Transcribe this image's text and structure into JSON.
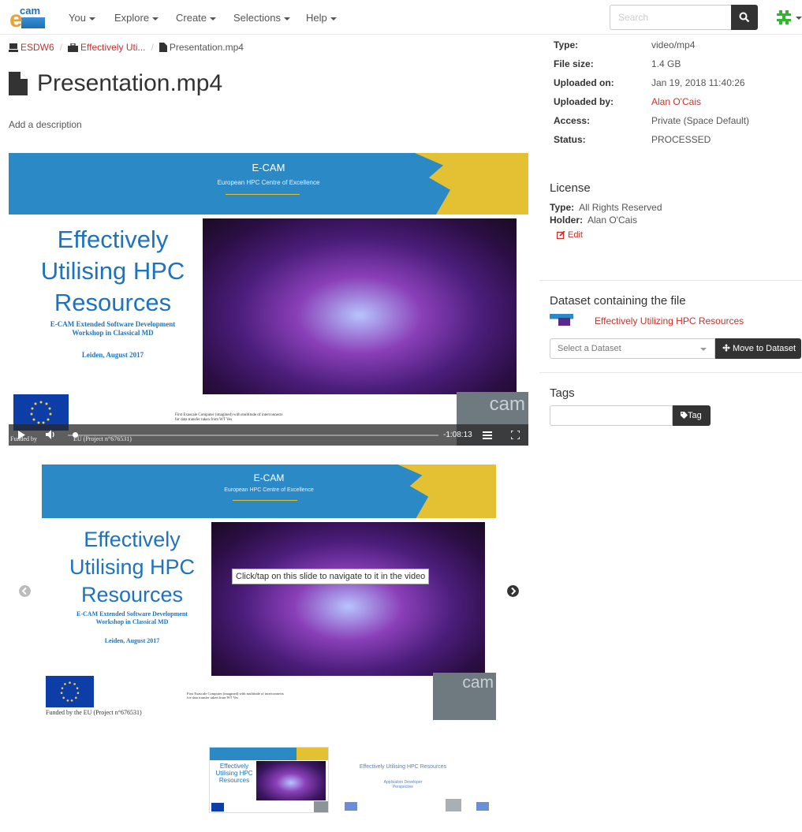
{
  "nav": {
    "logo_text": "cam",
    "logo_letter": "e",
    "items": [
      "You",
      "Explore",
      "Create",
      "Selections",
      "Help"
    ],
    "search_placeholder": "Search"
  },
  "breadcrumb": {
    "items": [
      "ESDW6",
      "Effectively Uti...",
      "Presentation.mp4"
    ]
  },
  "page": {
    "title": "Presentation.mp4",
    "add_description": "Add a description"
  },
  "slide": {
    "org": "E-CAM",
    "org_sub": "European HPC Centre of Excellence",
    "hero_lines": [
      "Effectively",
      "Utilising HPC",
      "Resources"
    ],
    "workshop_lines": [
      "E-CAM Extended Software Development",
      "Workshop in Classical MD"
    ],
    "location": "Leiden, August 2017",
    "caption_lines": [
      "First Exascale Computer (imagined) with multitude of interconnects",
      "for data transfer     taken from WT Ves"
    ],
    "funded": "Funded by the EU (Project n°676531)",
    "funded_partial_left": "Funded by",
    "funded_partial_right": "EU (Project n°676531)",
    "cam_text": "cam"
  },
  "video": {
    "remaining_time": "-1:08:13",
    "progress_fraction": 0.02
  },
  "carousel": {
    "tooltip": "Click/tap on this slide to navigate to it in the video"
  },
  "thumbs": {
    "second_title": "Effectively Utilising HPC Resources",
    "second_sub_lines": [
      "Application Developer",
      "Perspective"
    ]
  },
  "file_info": {
    "rows": [
      {
        "key": "Type:",
        "value": "video/mp4"
      },
      {
        "key": "File size:",
        "value": "1.4 GB"
      },
      {
        "key": "Uploaded on:",
        "value": "Jan 19, 2018 11:40:26"
      },
      {
        "key": "Uploaded by:",
        "value": "Alan O'Cais"
      },
      {
        "key": "Access:",
        "value": "Private (Space Default)"
      },
      {
        "key": "Status:",
        "value": "PROCESSED"
      }
    ]
  },
  "license": {
    "title": "License",
    "type_label": "Type:",
    "type_value": "All Rights Reserved",
    "holder_label": "Holder:",
    "holder_value": "Alan O'Cais",
    "edit_label": "Edit"
  },
  "dataset": {
    "title": "Dataset containing the file",
    "name": "Effectively Utilizing HPC Resources",
    "select_placeholder": "Select a Dataset",
    "move_label": "Move to Dataset"
  },
  "tags": {
    "title": "Tags",
    "button_label": "Tag"
  },
  "colors": {
    "link": "#c9302c",
    "banner": "#2b8ac6",
    "hero_text": "#1e73be",
    "eu_yellow": "#e3c133",
    "dark_button": "#333333"
  }
}
